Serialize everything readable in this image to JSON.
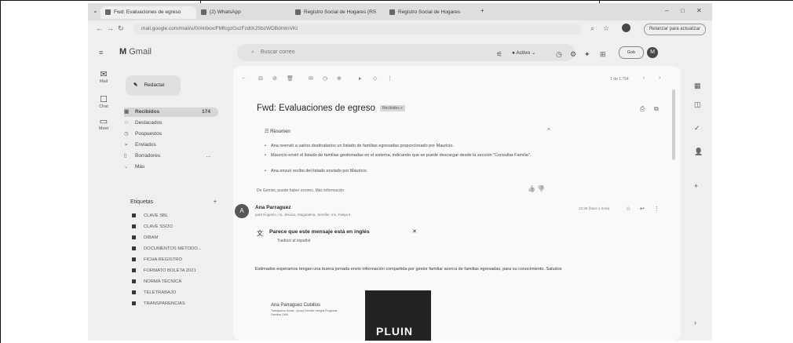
{
  "browser": {
    "tabs": [
      {
        "label": "Fwd: Evaluaciones de egreso",
        "active": true
      },
      {
        "label": "(2) WhatsApp",
        "active": false
      },
      {
        "label": "Registro Social de Hogares (RS",
        "active": false
      },
      {
        "label": "Registro Social de Hogares",
        "active": false
      }
    ],
    "url": "mail.google.com/mail/u/0/#inbox/FMfcgzGxzFzdtXJSbzWDBdmtnVKt",
    "reload_label": "Relanzar para actualizar"
  },
  "gmail": {
    "logo": "Gmail",
    "search_placeholder": "Buscar correo",
    "status": "Activo",
    "account_chip": "Gob",
    "account_initial": "M",
    "rail": [
      {
        "icon": "mail-icon",
        "label": "Mail"
      },
      {
        "icon": "chat-icon",
        "label": "Chat"
      },
      {
        "icon": "meet-icon",
        "label": "Meet"
      }
    ],
    "compose_label": "Redactar",
    "folders": [
      {
        "label": "Recibidos",
        "count": "174",
        "icon": "inbox-icon",
        "selected": true
      },
      {
        "label": "Destacados",
        "count": "",
        "icon": "star-icon",
        "selected": false
      },
      {
        "label": "Pospuestos",
        "count": "",
        "icon": "clock-icon",
        "selected": false
      },
      {
        "label": "Enviados",
        "count": "",
        "icon": "send-icon",
        "selected": false
      },
      {
        "label": "Borradores",
        "count": "...",
        "icon": "draft-icon",
        "selected": false
      },
      {
        "label": "Más",
        "count": "",
        "icon": "chevron-down-icon",
        "selected": false
      }
    ],
    "labels_title": "Etiquetas",
    "labels": [
      "CLAVE SBL",
      "CLAVE SSOO",
      "DIBAM",
      "DOCUMENTOS METODO...",
      "FICHA REGISTRO",
      "FORMATO BOLETA 2021",
      "NORMA TÉCNICA",
      "TELETRABAJO",
      "TRANSPARENCIAS"
    ],
    "pager": "1 de 1.754",
    "email": {
      "subject": "Fwd: Evaluaciones de egreso",
      "subject_tag": "Recibidos x",
      "summary_title": "Resumen",
      "summary_points": [
        "Ana reenvió a varios destinatarios un listado de familias egresadas proporcionado por Mauricio.",
        "Mauricio envió el listado de familias gestionadas en el sistema, indicando que se puede descargar desde la sección \"Consultar Familia\".",
        "Ana envuó recibo del listado enviado por Mauricio."
      ],
      "summary_disclaimer": "De Gemini, puede haber errores. Más información",
      "sender_initial": "A",
      "sender": "Ana Parraguez",
      "to_line": "para Eugenio, mi, Jessica, Magdalena, Jennifer, Iris, Fatiya ▾",
      "date": "12:30 (hace 1 hora)",
      "lang_title": "Parece que este mensaje está en inglés",
      "lang_action": "Traducir al español",
      "body": "Estimados esperamos tengan una buena jornada envio información compartida por gestor familiar acerca de familias egresadas, para su conocimiento. Saludos",
      "sig_name": "Ana Parraguez Cubillos",
      "sig_role": "Trabajadora Social - Apoyo Familiar Integral Programa Familias OMIL",
      "sig_brand": "PLUIN"
    }
  }
}
